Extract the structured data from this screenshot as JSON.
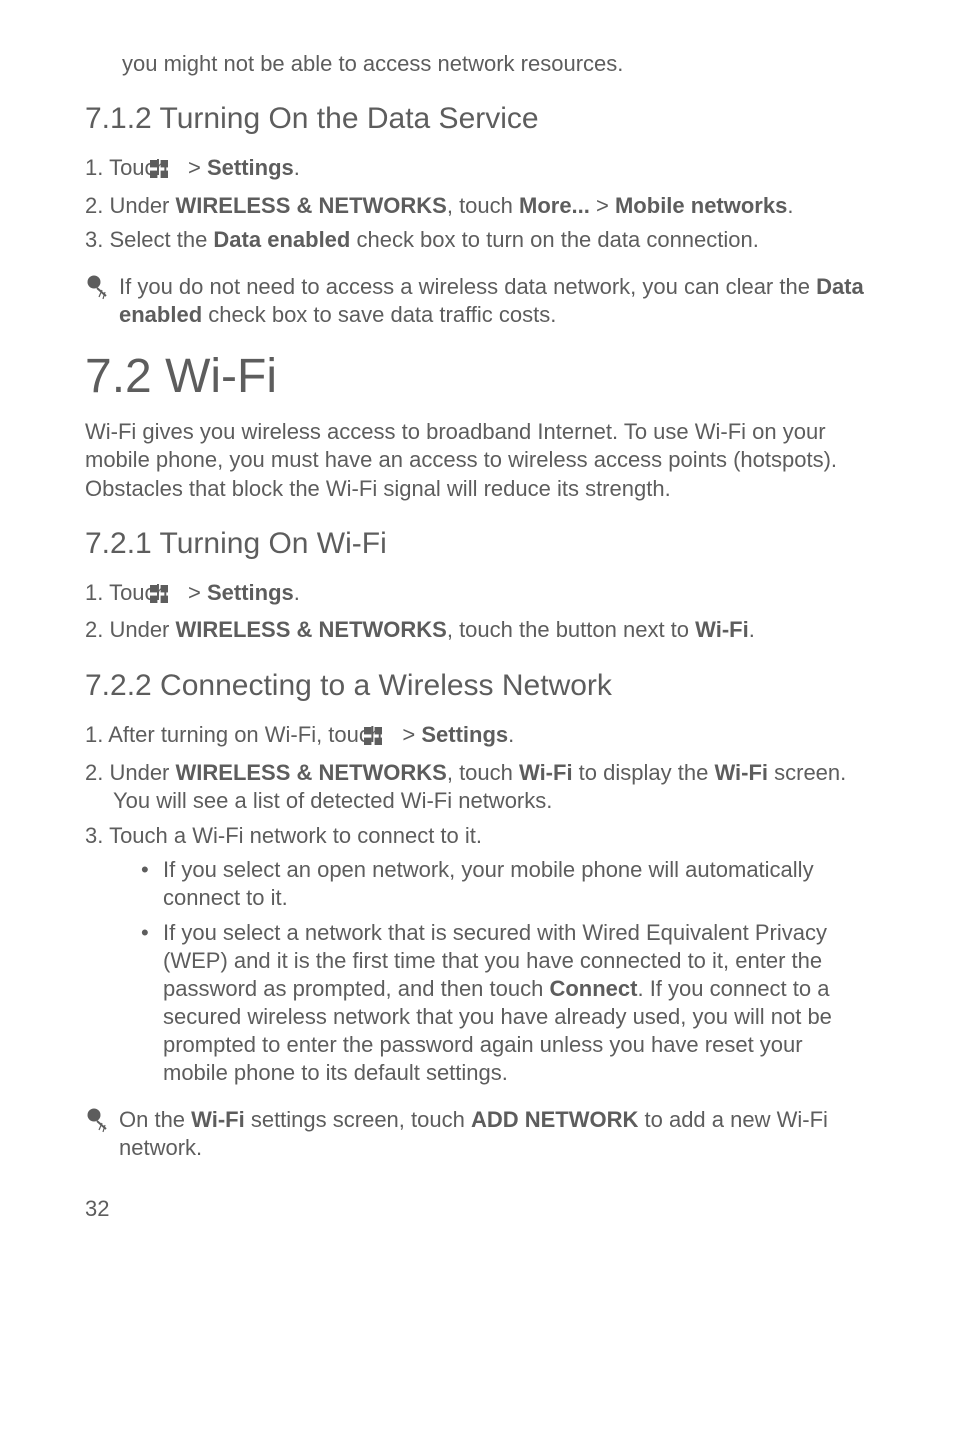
{
  "top_fragment": "you might not be able to access network resources.",
  "s712": {
    "heading": "7.1.2  Turning On the Data Service",
    "items": [
      {
        "pre": "1. Touch ",
        "post": " > ",
        "bold_tail": "Settings",
        "tail": "."
      },
      {
        "full": "2. Under ",
        "b1": "WIRELESS & NETWORKS",
        "mid1": ", touch ",
        "b2": "More...",
        "mid2": " > ",
        "b3": "Mobile networks",
        "end": "."
      },
      {
        "full": "3. Select the ",
        "b1": "Data enabled",
        "end": " check box to turn on the data connection."
      }
    ],
    "tip": {
      "t1": "If you do not need to access a wireless data network, you can clear the ",
      "b1": "Data enabled",
      "t2": " check box to save data traffic costs."
    }
  },
  "s72": {
    "heading": "7.2  Wi-Fi",
    "para": "Wi-Fi gives you wireless access to broadband Internet. To use Wi-Fi on your mobile phone, you must have an access to wireless access points (hotspots). Obstacles that block the Wi-Fi signal will reduce its strength."
  },
  "s721": {
    "heading": "7.2.1  Turning On Wi-Fi",
    "items": [
      {
        "pre": "1. Touch ",
        "post": " > ",
        "bold_tail": "Settings",
        "tail": "."
      },
      {
        "full": "2. Under ",
        "b1": "WIRELESS & NETWORKS",
        "mid1": ", touch the button next to ",
        "b2": "Wi-Fi",
        "end": "."
      }
    ]
  },
  "s722": {
    "heading": "7.2.2  Connecting to a Wireless Network",
    "items": [
      {
        "pre": "1. After turning on Wi-Fi, touch ",
        "post": " > ",
        "bold_tail": "Settings",
        "tail": "."
      },
      {
        "full": "2. Under ",
        "b1": "WIRELESS & NETWORKS",
        "mid1": ", touch ",
        "b2": "Wi-Fi",
        "mid2": " to display the ",
        "b3": "Wi-Fi",
        "end": " screen. You will see a list of detected Wi-Fi networks."
      },
      {
        "full": "3. Touch a Wi-Fi network to connect to it."
      }
    ],
    "bullets": [
      "If you select an open network, your mobile phone will automatically connect to it.",
      {
        "t1": "If you select a network that is secured with Wired Equivalent Privacy (WEP) and it is the first time that you have connected to it, enter the password as prompted, and then touch ",
        "b1": "Connect",
        "t2": ". If you connect to a secured wireless network that you have already used, you will not be prompted to enter the password again unless you have reset your mobile phone to its default settings."
      }
    ],
    "tip": {
      "t1": "On the ",
      "b1": "Wi-Fi",
      "t2": " settings screen, touch ",
      "b2": "ADD NETWORK",
      "t3": " to add a new Wi-Fi network."
    }
  },
  "page_number": "32"
}
